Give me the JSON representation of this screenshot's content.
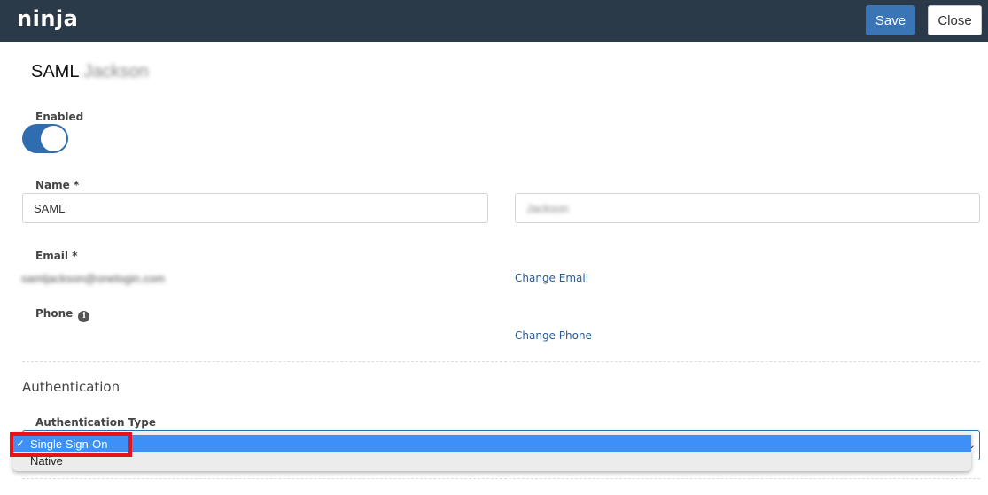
{
  "header": {
    "logo": "ninja",
    "save_label": "Save",
    "close_label": "Close",
    "save_color": "#3a75b5",
    "bg_color": "#2b3a49"
  },
  "page": {
    "title_first": "SAML",
    "title_last": "Jackson"
  },
  "form": {
    "enabled_label": "Enabled",
    "enabled": true,
    "name_label": "Name *",
    "first_name_value": "SAML",
    "last_name_value": "Jackson",
    "email_label": "Email *",
    "email_value": "samljackson@onelogin.com",
    "change_email_label": "Change Email",
    "phone_label": "Phone",
    "phone_info_icon": "info-icon",
    "change_phone_label": "Change Phone"
  },
  "authentication": {
    "section_title": "Authentication",
    "type_label": "Authentication Type",
    "selected": "Single Sign-On",
    "options": [
      {
        "label": "Single Sign-On",
        "checked": true,
        "check_glyph": "✓"
      },
      {
        "label": "Native",
        "checked": false
      }
    ],
    "highlight_color": "#e8121b",
    "selected_option_color": "#3d90f7"
  }
}
